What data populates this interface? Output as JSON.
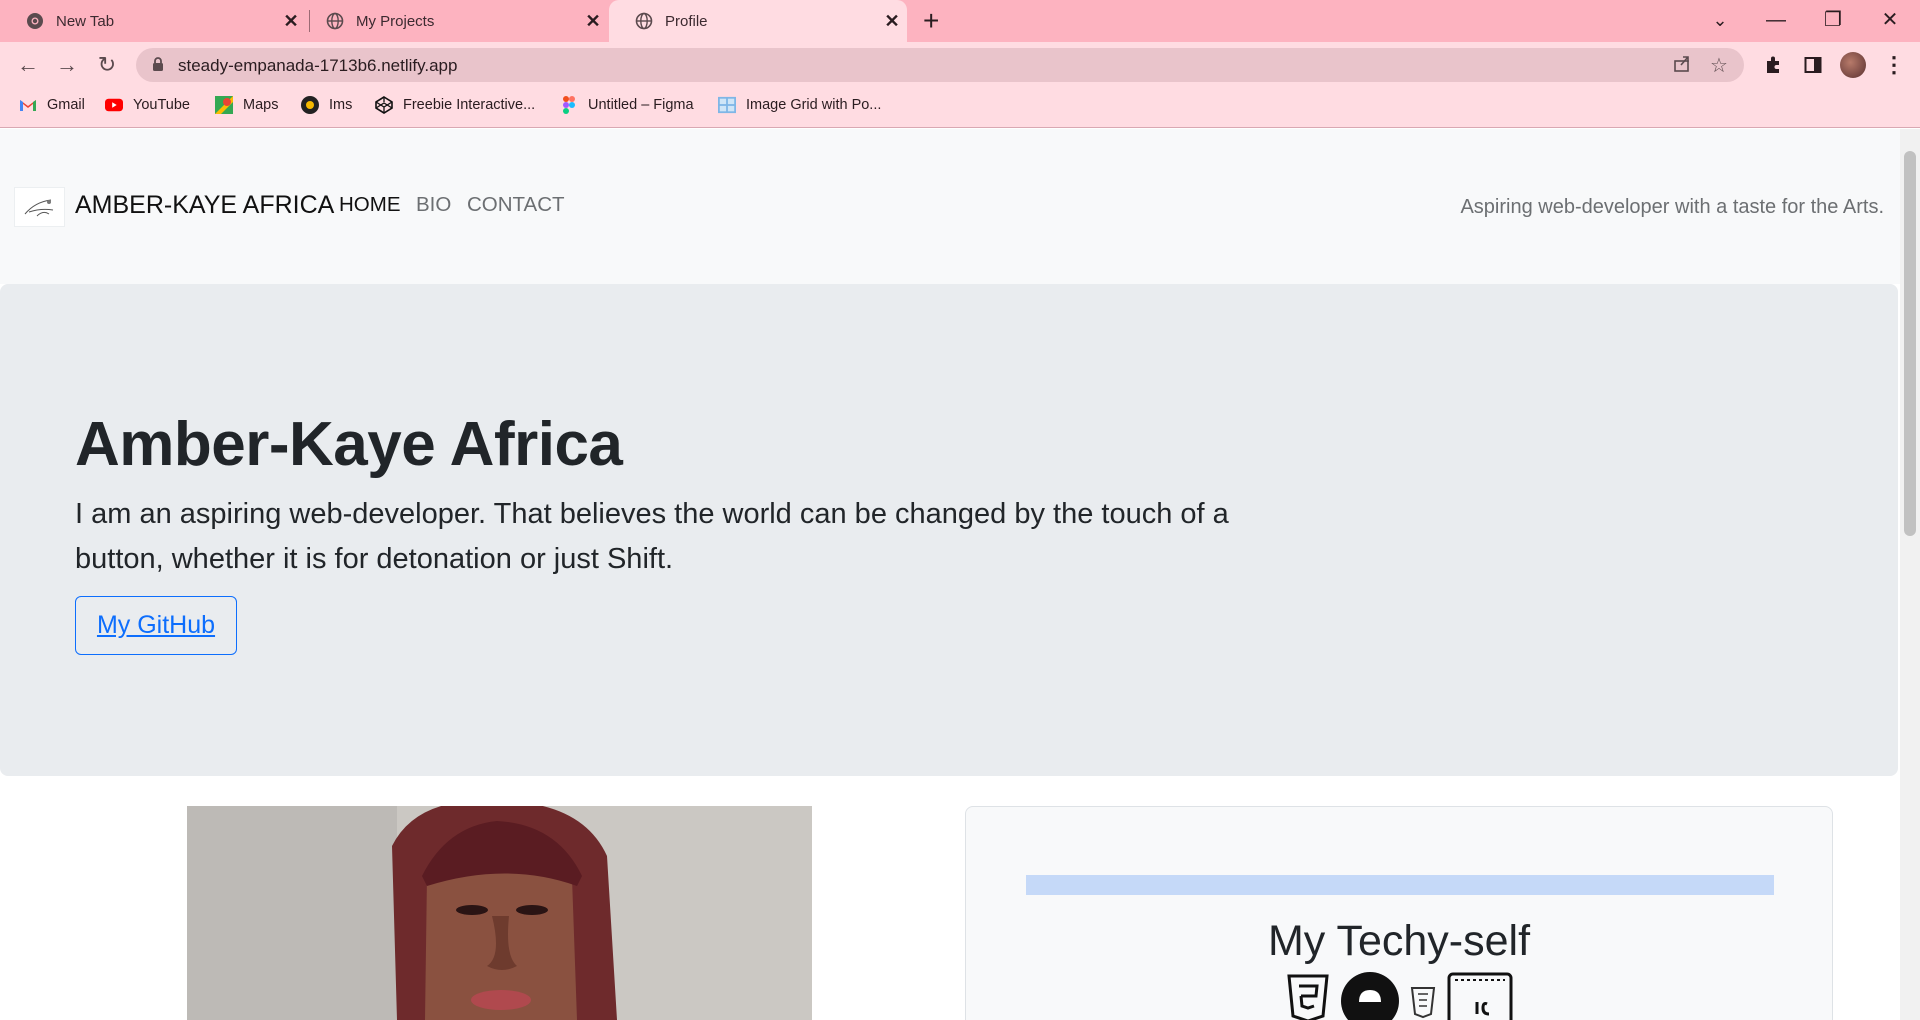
{
  "browser": {
    "tabs": [
      {
        "title": "New Tab",
        "icon": "chrome-icon"
      },
      {
        "title": "My Projects",
        "icon": "globe-icon"
      },
      {
        "title": "Profile",
        "icon": "globe-icon",
        "active": true
      }
    ],
    "address": "steady-empanada-1713b6.netlify.app",
    "bookmarks": [
      {
        "label": "Gmail",
        "icon": "gmail-icon"
      },
      {
        "label": "YouTube",
        "icon": "youtube-icon"
      },
      {
        "label": "Maps",
        "icon": "maps-icon"
      },
      {
        "label": "Ims",
        "icon": "ims-icon"
      },
      {
        "label": "Freebie Interactive...",
        "icon": "codepen-icon"
      },
      {
        "label": "Untitled – Figma",
        "icon": "figma-icon"
      },
      {
        "label": "Image Grid with Po...",
        "icon": "image-icon"
      }
    ],
    "colors": {
      "tabstrip": "#fdb3c0",
      "toolbar": "#ffdce2",
      "omnibox": "#e9c4cb"
    }
  },
  "site": {
    "nav": {
      "brand": "AMBER-KAYE AFRICA",
      "links": [
        "HOME",
        "BIO",
        "CONTACT"
      ],
      "tagline": "Aspiring web-developer with a taste for the Arts."
    },
    "hero": {
      "title": "Amber-Kaye Africa",
      "text": "I am an aspiring web-developer. That believes the world can be changed by the touch of a button, whether it is for detonation or just Shift.",
      "button": "My GitHub"
    },
    "card": {
      "heading": "My Techy-self",
      "icons": [
        "css3-icon",
        "github-icon",
        "html5-icon",
        "js-icon"
      ]
    },
    "colors": {
      "accent": "#0d6efd",
      "hero_bg": "#e9ecef",
      "navbar_bg": "#f8f9fa",
      "progress": "#c5d9f8"
    }
  }
}
